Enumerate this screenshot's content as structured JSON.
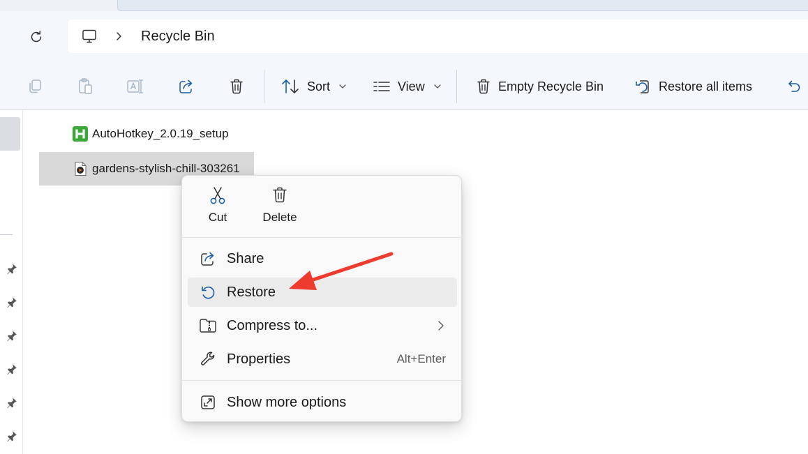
{
  "address": {
    "location_icon": "this-pc-icon",
    "crumb": "Recycle Bin"
  },
  "toolbar": {
    "sort_label": "Sort",
    "view_label": "View",
    "empty_label": "Empty Recycle Bin",
    "restore_all_label": "Restore all items"
  },
  "files": [
    {
      "name": "AutoHotkey_2.0.19_setup",
      "icon": "autohotkey-icon"
    },
    {
      "name": "gardens-stylish-chill-303261",
      "icon": "audio-file-icon"
    }
  ],
  "context_menu": {
    "cut_label": "Cut",
    "delete_label": "Delete",
    "items": [
      {
        "label": "Share",
        "icon": "share-icon"
      },
      {
        "label": "Restore",
        "icon": "restore-icon"
      },
      {
        "label": "Compress to...",
        "icon": "zip-folder-icon"
      },
      {
        "label": "Properties",
        "icon": "wrench-icon",
        "shortcut": "Alt+Enter"
      },
      {
        "label": "Show more options",
        "icon": "show-more-icon"
      }
    ]
  },
  "colors": {
    "accent": "#0067c0",
    "annotation_arrow": "#ee3b2f",
    "autohotkey_green": "#3da638"
  }
}
